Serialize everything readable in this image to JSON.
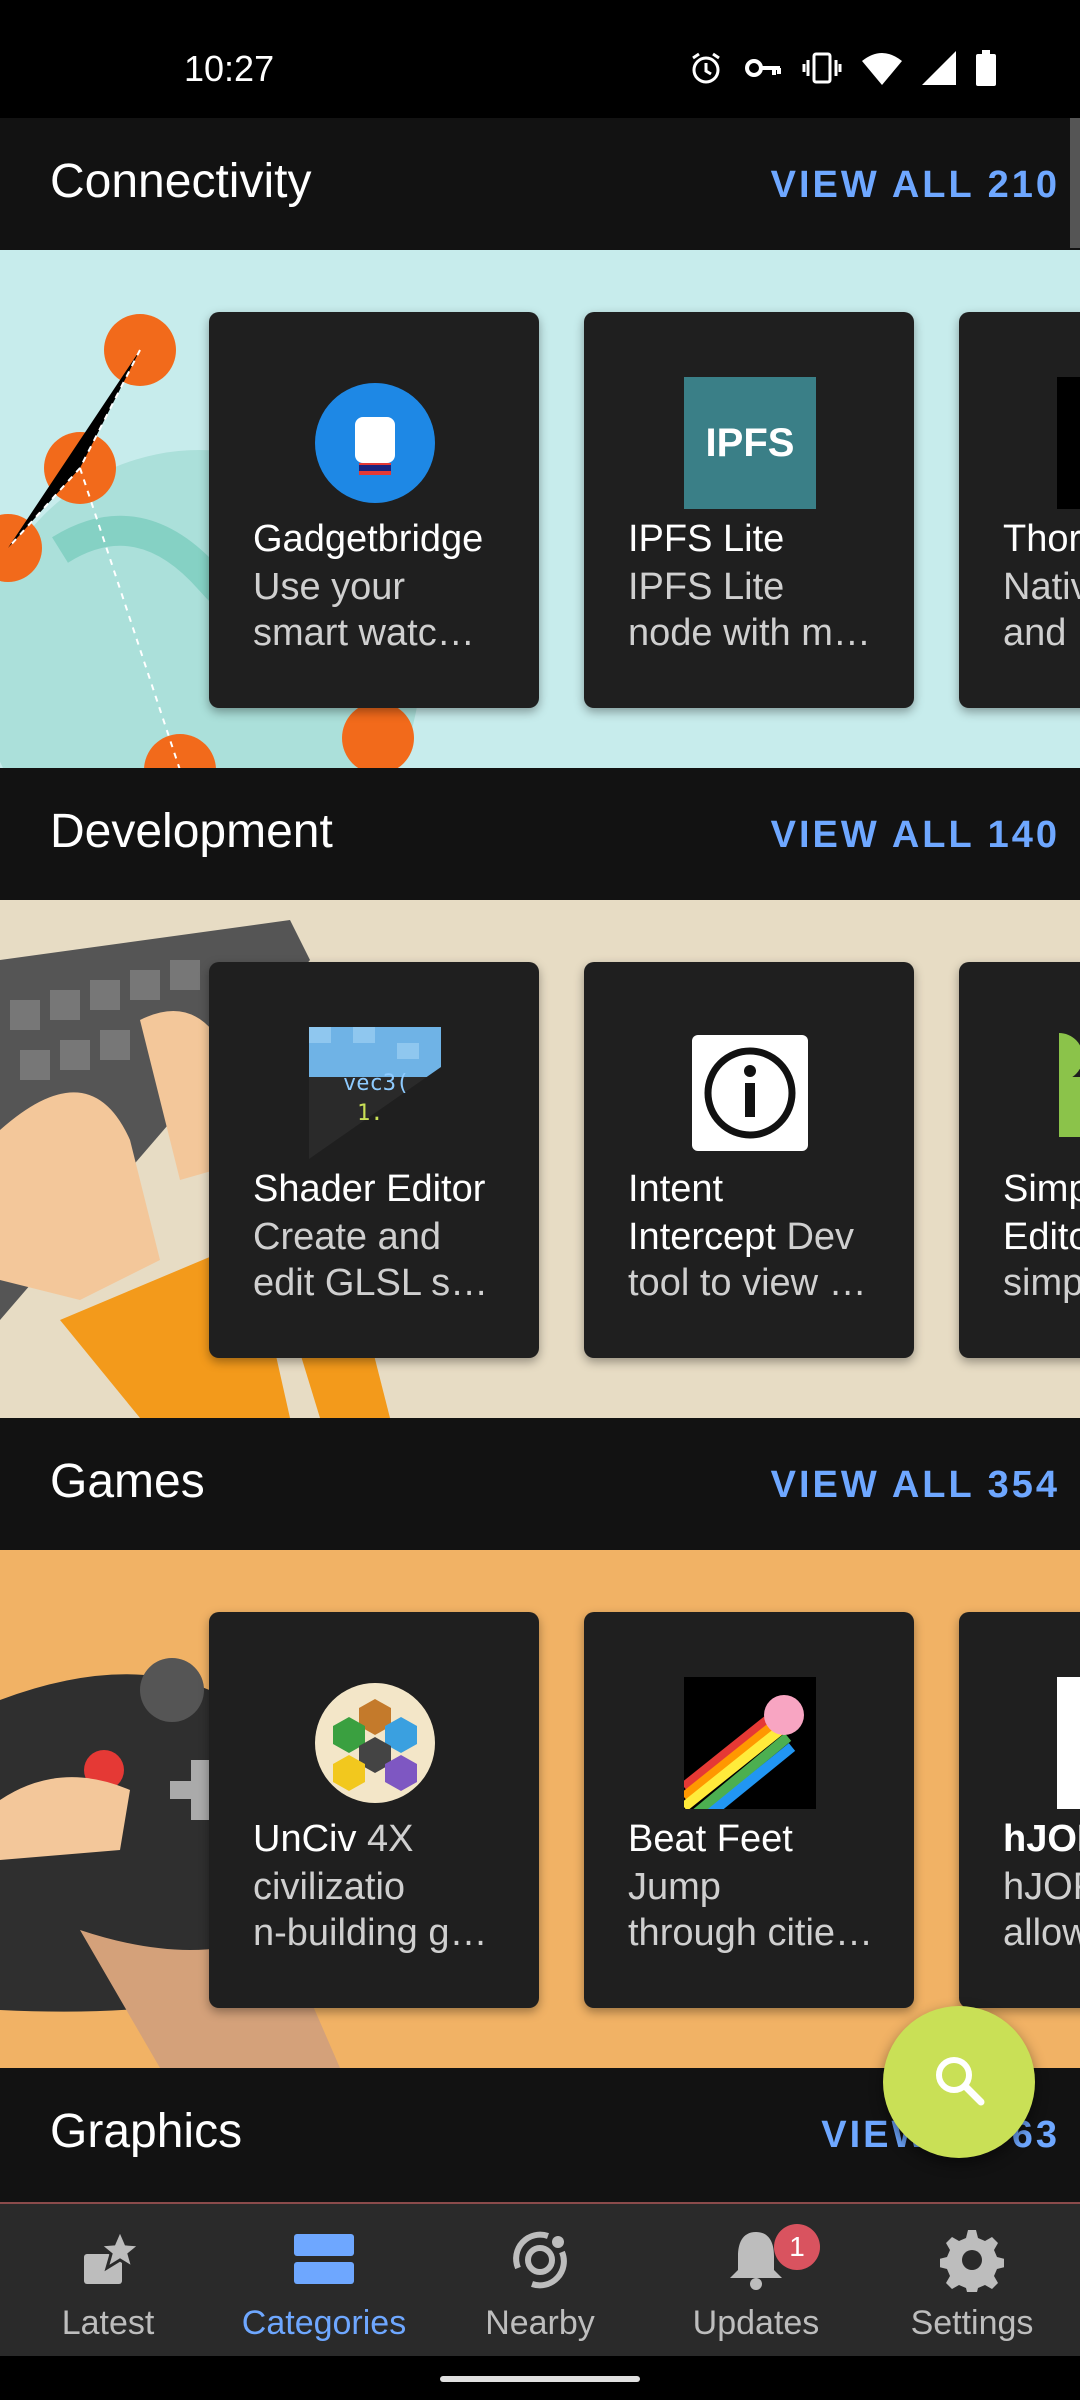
{
  "status_bar": {
    "time": "10:27",
    "icons": [
      "alarm-icon",
      "vpn-key-icon",
      "vibrate-icon",
      "wifi-icon",
      "signal-icon",
      "battery-icon"
    ]
  },
  "sections": [
    {
      "title": "Connectivity",
      "view_all": "VIEW ALL 210",
      "banner_color": "#c7ecec",
      "cards": [
        {
          "name": "Gadgetbridge",
          "desc_lines": [
            "Use your",
            "smart watc…"
          ],
          "icon": "gadgetbridge-icon"
        },
        {
          "name": "IPFS Lite",
          "desc_lines": [
            "IPFS Lite",
            "node with m…"
          ],
          "icon": "ipfs-lite-icon",
          "icon_text": "IPFS"
        },
        {
          "name": "Thor",
          "desc_lines": [
            "Nativ",
            "and I"
          ],
          "icon": "app-icon"
        }
      ]
    },
    {
      "title": "Development",
      "view_all": "VIEW ALL 140",
      "banner_color": "#e7dcc4",
      "cards": [
        {
          "name": "Shader Editor",
          "desc_lines": [
            "Create and",
            "edit GLSL s…"
          ],
          "icon": "shader-editor-icon",
          "icon_text": "vec3(",
          "icon_text2": "1."
        },
        {
          "name": "Intent",
          "name2": "Intercept",
          "desc_inline": "Dev",
          "desc_lines": [
            "tool to view …"
          ],
          "icon": "info-icon"
        },
        {
          "name": "Simp",
          "name2": "Edito",
          "desc_lines": [
            "simp"
          ],
          "icon": "android-icon"
        }
      ]
    },
    {
      "title": "Games",
      "view_all": "VIEW ALL 354",
      "banner_color": "#f1b265",
      "cards": [
        {
          "name": "UnCiv",
          "desc_inline": "4X",
          "desc_lines": [
            "civilizatio",
            "n-building g…"
          ],
          "icon": "unciv-icon"
        },
        {
          "name": "Beat Feet",
          "desc_lines": [
            "Jump",
            "through citie…"
          ],
          "icon": "beat-feet-icon"
        },
        {
          "name": "hJOF",
          "desc_lines": [
            "hJOF",
            "allow"
          ],
          "icon": "app-icon"
        }
      ]
    },
    {
      "title": "Graphics",
      "view_all": "VIEW ALL 63",
      "view_all_visible": "VIEW      63"
    }
  ],
  "fab": {
    "icon": "search-icon",
    "color": "#c9e056"
  },
  "bottom_nav": {
    "items": [
      {
        "label": "Latest",
        "icon": "star-icon"
      },
      {
        "label": "Categories",
        "icon": "categories-icon",
        "active": true
      },
      {
        "label": "Nearby",
        "icon": "nearby-icon"
      },
      {
        "label": "Updates",
        "icon": "bell-icon",
        "badge": "1"
      },
      {
        "label": "Settings",
        "icon": "gear-icon"
      }
    ]
  },
  "colors": {
    "accent": "#6ea7ff",
    "background": "#121212",
    "card": "#1f1f1f",
    "badge": "#d9535f"
  }
}
